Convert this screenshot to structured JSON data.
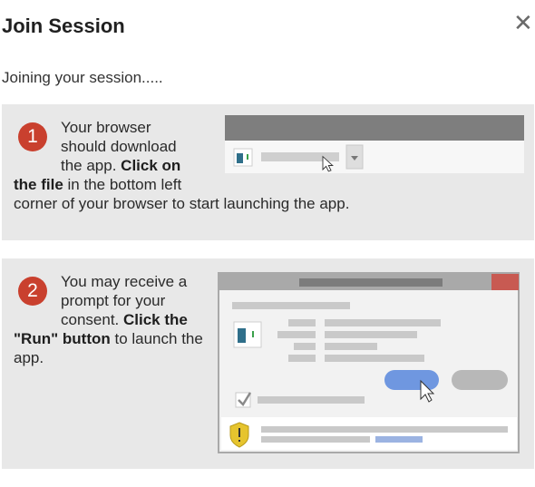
{
  "dialog": {
    "title": "Join Session",
    "close_symbol": "✕",
    "status_text": "Joining your session....."
  },
  "steps": [
    {
      "number": "1",
      "lines": [
        {
          "pre": "Your browser",
          "bold": "",
          "post": ""
        },
        {
          "pre": "should download",
          "bold": "",
          "post": ""
        },
        {
          "pre": "the app. ",
          "bold": "Click on",
          "post": ""
        },
        {
          "pre": "",
          "bold": "the file",
          "post": " in the bottom left"
        },
        {
          "pre": "corner of your browser to start launching the app.",
          "bold": "",
          "post": ""
        }
      ],
      "illustration": "browser-download-bar"
    },
    {
      "number": "2",
      "lines": [
        {
          "pre": "You may receive a",
          "bold": "",
          "post": ""
        },
        {
          "pre": "prompt for your",
          "bold": "",
          "post": ""
        },
        {
          "pre": "consent. ",
          "bold": "Click the",
          "post": ""
        },
        {
          "pre": "",
          "bold": "\"Run\" button",
          "post": " to launch the"
        },
        {
          "pre": "app.",
          "bold": "",
          "post": ""
        }
      ],
      "illustration": "run-consent-dialog"
    }
  ],
  "colors": {
    "step_badge": "#c9402e",
    "card_bg": "#e8e8e8",
    "run_button": "#6f97e0",
    "shield": "#e6c42e",
    "window_close": "#c85a52"
  }
}
